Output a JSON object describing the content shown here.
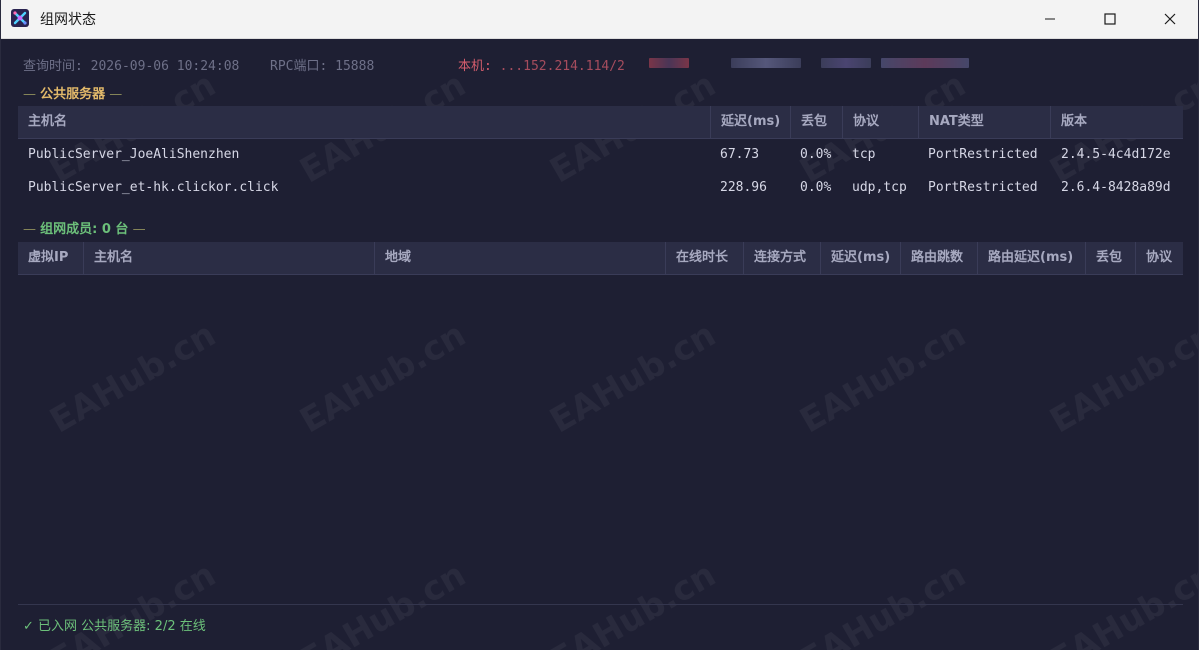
{
  "window": {
    "title": "组网状态",
    "icon": "app-logo-icon",
    "controls": [
      "minimize-icon",
      "maximize-icon",
      "close-icon"
    ]
  },
  "info": {
    "query_time": "查询时间: 2026-09-06 10:24:08",
    "rpc_port": "RPC端口: 15888",
    "local_label": "本机:",
    "local_value": "...152.214.114/2"
  },
  "public_servers": {
    "title": "公共服务器",
    "columns": [
      "主机名",
      "延迟(ms)",
      "丢包",
      "协议",
      "NAT类型",
      "版本"
    ],
    "rows": [
      [
        "PublicServer_JoeAliShenzhen",
        "67.73",
        "0.0%",
        "tcp",
        "PortRestricted",
        "2.4.5-4c4d172e"
      ],
      [
        "PublicServer_et-hk.clickor.click",
        "228.96",
        "0.0%",
        "udp,tcp",
        "PortRestricted",
        "2.6.4-8428a89d"
      ]
    ]
  },
  "members": {
    "title": "组网成员: 0 台",
    "columns": [
      "虚拟IP",
      "主机名",
      "地域",
      "在线时长",
      "连接方式",
      "延迟(ms)",
      "路由跳数",
      "路由延迟(ms)",
      "丢包",
      "协议"
    ],
    "rows": []
  },
  "status": {
    "text": "✓ 已入网  公共服务器: 2/2 在线"
  },
  "watermark": "EAHub.cn",
  "colors": {
    "background": "#1e1f33",
    "header_bg": "#2b2d45",
    "public_title": "#e2b96a",
    "members_title": "#6cc07a",
    "local_ip": "#d35c6c"
  }
}
